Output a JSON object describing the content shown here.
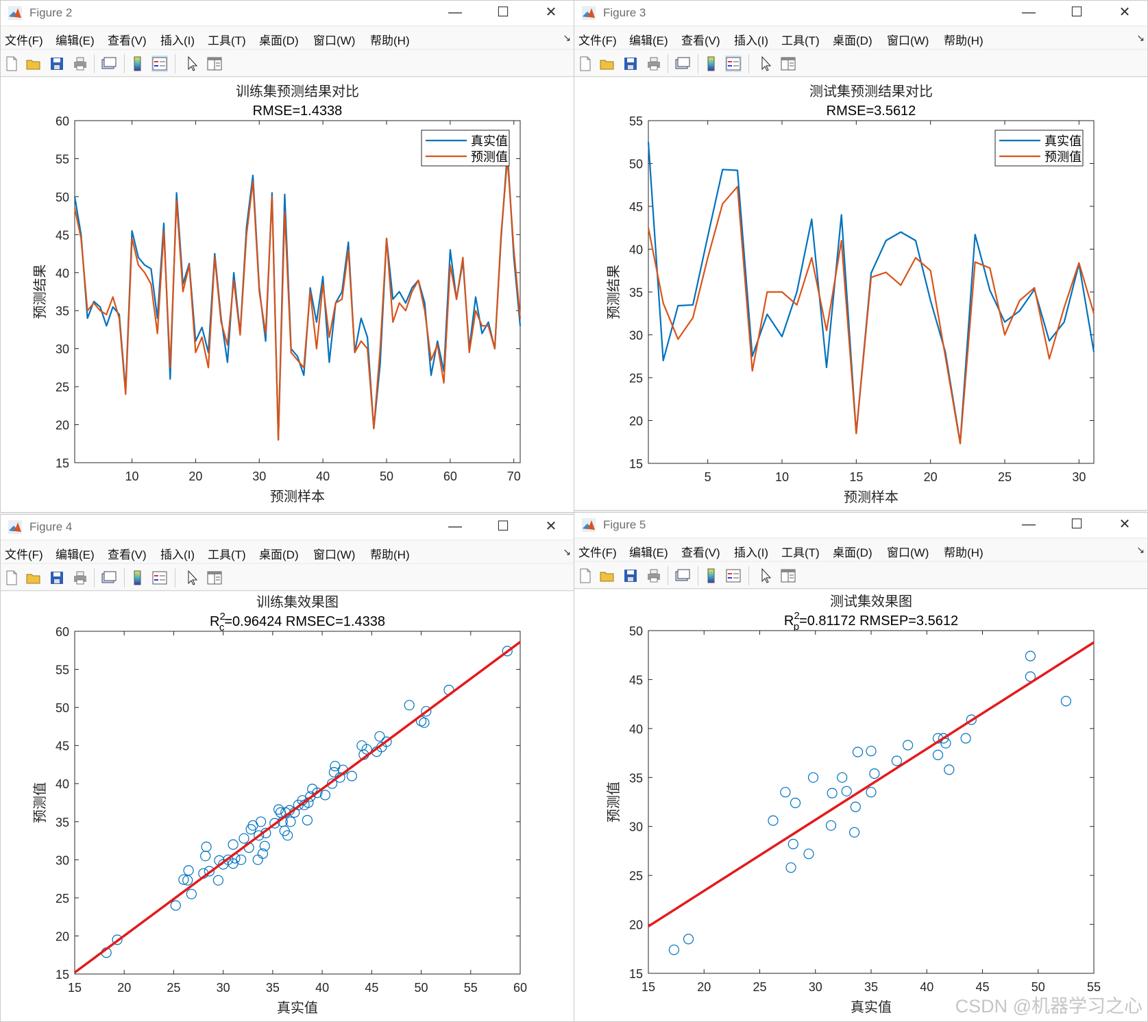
{
  "menus": [
    "文件(F)",
    "编辑(E)",
    "查看(V)",
    "插入(I)",
    "工具(T)",
    "桌面(D)",
    "窗口(W)",
    "帮助(H)"
  ],
  "toolbar_icons": [
    "new-file-icon",
    "open-folder-icon",
    "save-icon",
    "print-icon",
    "print-preview-icon",
    "colorbar-icon",
    "legend-icon",
    "select-cursor-icon",
    "property-inspector-icon"
  ],
  "window_controls": {
    "minimize": "—",
    "maximize": "☐",
    "close": "✕"
  },
  "watermark": "CSDN @机器学习之心",
  "colors": {
    "true_series": "#0072BD",
    "pred_series": "#D95319",
    "fit_line": "#E41A1C",
    "scatter": "#0072BD"
  },
  "figures": [
    {
      "title": "Figure 2"
    },
    {
      "title": "Figure 3"
    },
    {
      "title": "Figure 4"
    },
    {
      "title": "Figure 5"
    }
  ],
  "chart_data": [
    {
      "type": "line",
      "title": "训练集预测结果对比",
      "subtitle": "RMSE=1.4338",
      "xlabel": "预测样本",
      "ylabel": "预测结果",
      "xlim": [
        1,
        71
      ],
      "ylim": [
        15,
        60
      ],
      "xticks": [
        10,
        20,
        30,
        40,
        50,
        60,
        70
      ],
      "yticks": [
        15,
        20,
        25,
        30,
        35,
        40,
        45,
        50,
        55,
        60
      ],
      "legend": "top-right",
      "grid": false,
      "x": [
        1,
        2,
        3,
        4,
        5,
        6,
        7,
        8,
        9,
        10,
        11,
        12,
        13,
        14,
        15,
        16,
        17,
        18,
        19,
        20,
        21,
        22,
        23,
        24,
        25,
        26,
        27,
        28,
        29,
        30,
        31,
        32,
        33,
        34,
        35,
        36,
        37,
        38,
        39,
        40,
        41,
        42,
        43,
        44,
        45,
        46,
        47,
        48,
        49,
        50,
        51,
        52,
        53,
        54,
        55,
        56,
        57,
        58,
        59,
        60,
        61,
        62,
        63,
        64,
        65,
        66,
        67,
        68,
        69,
        70,
        71
      ],
      "series": [
        {
          "name": "真实值",
          "values": [
            50.0,
            45.0,
            34.0,
            36.2,
            35.5,
            33.0,
            35.5,
            34.5,
            24.5,
            45.5,
            42.0,
            41.0,
            40.5,
            34.0,
            46.5,
            26.0,
            50.5,
            38.5,
            41.2,
            31.0,
            32.8,
            29.5,
            42.5,
            34.0,
            28.2,
            40.0,
            32.0,
            46.0,
            52.8,
            38.0,
            31.0,
            50.5,
            18.0,
            50.3,
            30.0,
            29.0,
            26.5,
            38.0,
            33.5,
            39.5,
            28.2,
            36.0,
            37.5,
            44.0,
            29.5,
            34.0,
            31.5,
            19.5,
            28.0,
            44.5,
            36.5,
            37.5,
            36.0,
            38.0,
            39.0,
            36.0,
            26.5,
            31.0,
            27.0,
            43.0,
            36.5,
            41.5,
            30.0,
            36.8,
            32.0,
            33.5,
            30.0,
            44.5,
            56.0,
            42.0,
            33.0
          ]
        },
        {
          "name": "预测值",
          "values": [
            48.5,
            44.5,
            35.0,
            36.0,
            35.0,
            34.5,
            36.8,
            34.0,
            24.0,
            44.5,
            41.0,
            40.0,
            38.5,
            32.0,
            45.5,
            27.5,
            49.5,
            37.5,
            41.0,
            29.5,
            31.5,
            27.5,
            42.0,
            33.5,
            30.5,
            39.0,
            31.8,
            45.0,
            52.0,
            37.5,
            32.0,
            50.0,
            18.0,
            48.0,
            29.5,
            28.5,
            27.5,
            37.5,
            30.0,
            38.5,
            31.5,
            36.0,
            36.5,
            43.0,
            29.5,
            31.0,
            30.0,
            19.5,
            30.0,
            44.5,
            33.5,
            36.0,
            35.0,
            37.5,
            39.0,
            35.0,
            28.5,
            30.5,
            25.5,
            41.0,
            36.5,
            42.0,
            29.5,
            35.0,
            33.0,
            33.0,
            30.0,
            45.0,
            55.0,
            43.0,
            34.0
          ]
        }
      ]
    },
    {
      "type": "line",
      "title": "测试集预测结果对比",
      "subtitle": "RMSE=3.5612",
      "xlabel": "预测样本",
      "ylabel": "预测结果",
      "xlim": [
        1,
        31
      ],
      "ylim": [
        15,
        55
      ],
      "xticks": [
        5,
        10,
        15,
        20,
        25,
        30
      ],
      "yticks": [
        15,
        20,
        25,
        30,
        35,
        40,
        45,
        50,
        55
      ],
      "legend": "top-right",
      "grid": false,
      "x": [
        1,
        2,
        3,
        4,
        5,
        6,
        7,
        8,
        9,
        10,
        11,
        12,
        13,
        14,
        15,
        16,
        17,
        18,
        19,
        20,
        21,
        22,
        23,
        24,
        25,
        26,
        27,
        28,
        29,
        30,
        31
      ],
      "series": [
        {
          "name": "真实值",
          "values": [
            52.5,
            27.0,
            33.4,
            33.5,
            41.5,
            49.3,
            49.2,
            27.5,
            32.4,
            29.8,
            35.0,
            43.5,
            26.2,
            44.0,
            18.5,
            37.2,
            41.0,
            42.0,
            41.0,
            34.0,
            28.0,
            17.4,
            41.7,
            35.2,
            31.5,
            32.8,
            35.3,
            29.3,
            31.5,
            38.3,
            28.0
          ]
        },
        {
          "name": "预测值",
          "values": [
            42.5,
            33.7,
            29.5,
            32.0,
            39.0,
            45.3,
            47.3,
            25.8,
            35.0,
            35.0,
            33.5,
            39.0,
            30.5,
            41.0,
            18.5,
            36.7,
            37.3,
            35.8,
            39.0,
            37.5,
            27.5,
            17.3,
            38.5,
            37.8,
            30.0,
            34.0,
            35.5,
            27.2,
            33.2,
            38.4,
            32.5
          ]
        }
      ]
    },
    {
      "type": "scatter",
      "title": "训练集效果图",
      "subtitle_parts": {
        "prefix": "R",
        "sup": "2",
        "sub": "c",
        "rest": "=0.96424  RMSEC=1.4338"
      },
      "xlabel": "真实值",
      "ylabel": "预测值",
      "xlim": [
        15,
        60
      ],
      "ylim": [
        15,
        60
      ],
      "xticks": [
        15,
        20,
        25,
        30,
        35,
        40,
        45,
        50,
        55,
        60
      ],
      "yticks": [
        15,
        20,
        25,
        30,
        35,
        40,
        45,
        50,
        55,
        60
      ],
      "grid": false,
      "fit_line": {
        "x": [
          15,
          60
        ],
        "y": [
          15.2,
          58.6
        ]
      },
      "points": [
        [
          18.2,
          17.8
        ],
        [
          19.3,
          19.5
        ],
        [
          25.2,
          24.0
        ],
        [
          26.0,
          27.4
        ],
        [
          26.5,
          28.6
        ],
        [
          26.4,
          27.3
        ],
        [
          26.8,
          25.5
        ],
        [
          28.0,
          28.2
        ],
        [
          28.2,
          30.5
        ],
        [
          28.3,
          31.7
        ],
        [
          28.6,
          28.5
        ],
        [
          29.5,
          27.3
        ],
        [
          29.6,
          29.9
        ],
        [
          30.0,
          29.4
        ],
        [
          30.5,
          30.0
        ],
        [
          31.0,
          29.5
        ],
        [
          31.0,
          32.0
        ],
        [
          31.2,
          30.2
        ],
        [
          31.8,
          30.0
        ],
        [
          32.1,
          32.8
        ],
        [
          32.6,
          31.6
        ],
        [
          32.8,
          34.0
        ],
        [
          33.0,
          34.5
        ],
        [
          33.5,
          30.0
        ],
        [
          33.6,
          33.2
        ],
        [
          33.8,
          35.0
        ],
        [
          34.0,
          30.8
        ],
        [
          34.2,
          31.8
        ],
        [
          34.3,
          33.5
        ],
        [
          35.2,
          34.8
        ],
        [
          35.6,
          36.6
        ],
        [
          35.8,
          36.2
        ],
        [
          36.0,
          35.0
        ],
        [
          36.2,
          33.8
        ],
        [
          36.3,
          36.2
        ],
        [
          36.5,
          33.2
        ],
        [
          36.7,
          36.5
        ],
        [
          36.8,
          35.0
        ],
        [
          37.2,
          36.2
        ],
        [
          37.6,
          37.2
        ],
        [
          38.0,
          37.8
        ],
        [
          38.2,
          37.2
        ],
        [
          38.5,
          35.2
        ],
        [
          38.6,
          37.5
        ],
        [
          38.8,
          38.3
        ],
        [
          39.0,
          39.3
        ],
        [
          39.5,
          38.8
        ],
        [
          40.3,
          38.5
        ],
        [
          41.0,
          40.0
        ],
        [
          41.2,
          41.5
        ],
        [
          41.3,
          42.3
        ],
        [
          41.8,
          40.8
        ],
        [
          42.1,
          41.8
        ],
        [
          43.0,
          41.0
        ],
        [
          44.0,
          45.0
        ],
        [
          44.2,
          43.8
        ],
        [
          44.5,
          44.5
        ],
        [
          45.5,
          44.2
        ],
        [
          45.8,
          46.2
        ],
        [
          46.0,
          44.8
        ],
        [
          46.5,
          45.5
        ],
        [
          48.8,
          50.3
        ],
        [
          50.0,
          48.2
        ],
        [
          50.3,
          48.0
        ],
        [
          50.5,
          49.5
        ],
        [
          52.8,
          52.3
        ],
        [
          58.7,
          57.4
        ]
      ]
    },
    {
      "type": "scatter",
      "title": "测试集效果图",
      "subtitle_parts": {
        "prefix": "R",
        "sup": "2",
        "sub": "p",
        "rest": "=0.81172  RMSEP=3.5612"
      },
      "xlabel": "真实值",
      "ylabel": "预测值",
      "xlim": [
        15,
        55
      ],
      "ylim": [
        15,
        50
      ],
      "xticks": [
        15,
        20,
        25,
        30,
        35,
        40,
        45,
        50,
        55
      ],
      "yticks": [
        15,
        20,
        25,
        30,
        35,
        40,
        45,
        50
      ],
      "grid": false,
      "fit_line": {
        "x": [
          15,
          55
        ],
        "y": [
          19.8,
          48.8
        ]
      },
      "points": [
        [
          17.3,
          17.4
        ],
        [
          18.6,
          18.5
        ],
        [
          26.2,
          30.6
        ],
        [
          27.3,
          33.5
        ],
        [
          27.8,
          25.8
        ],
        [
          28.0,
          28.2
        ],
        [
          28.2,
          32.4
        ],
        [
          29.4,
          27.2
        ],
        [
          29.8,
          35.0
        ],
        [
          31.4,
          30.1
        ],
        [
          31.5,
          33.4
        ],
        [
          32.4,
          35.0
        ],
        [
          32.8,
          33.6
        ],
        [
          33.5,
          29.4
        ],
        [
          33.6,
          32.0
        ],
        [
          33.8,
          37.6
        ],
        [
          35.0,
          37.7
        ],
        [
          35.0,
          33.5
        ],
        [
          35.3,
          35.4
        ],
        [
          37.3,
          36.7
        ],
        [
          38.3,
          38.3
        ],
        [
          41.0,
          39.0
        ],
        [
          41.0,
          37.3
        ],
        [
          41.5,
          39.0
        ],
        [
          41.7,
          38.5
        ],
        [
          42.0,
          35.8
        ],
        [
          43.5,
          39.0
        ],
        [
          44.0,
          40.9
        ],
        [
          49.3,
          47.4
        ],
        [
          49.3,
          45.3
        ],
        [
          52.5,
          42.8
        ]
      ]
    }
  ]
}
